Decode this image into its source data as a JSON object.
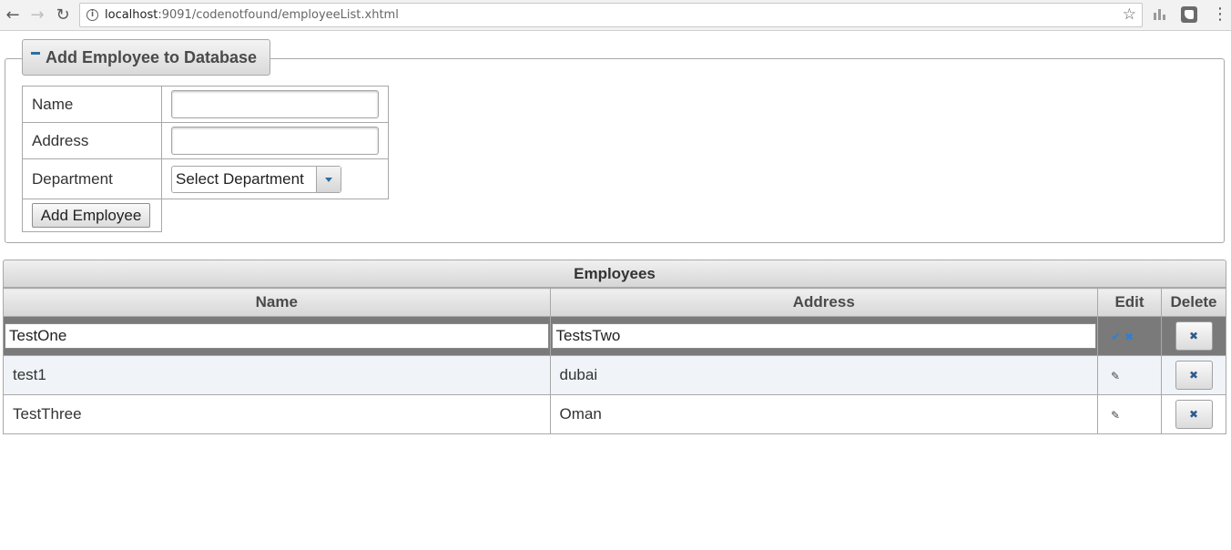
{
  "browser": {
    "url_host": "localhost",
    "url_rest": ":9091/codenotfound/employeeList.xhtml"
  },
  "add_panel": {
    "legend": "Add Employee to Database",
    "name_label": "Name",
    "name_value": "",
    "address_label": "Address",
    "address_value": "",
    "department_label": "Department",
    "department_selected": "Select Department",
    "submit_label": "Add Employee"
  },
  "employees": {
    "caption": "Employees",
    "columns": [
      "Name",
      "Address",
      "Edit",
      "Delete"
    ],
    "editing_row": {
      "name": "TestOne",
      "address": "TestsTwo"
    },
    "rows": [
      {
        "name": "test1",
        "address": "dubai"
      },
      {
        "name": "TestThree",
        "address": "Oman"
      }
    ]
  },
  "icons": {
    "back": "back-arrow-icon",
    "forward": "forward-arrow-icon",
    "reload": "reload-icon",
    "info": "info-icon",
    "star": "star-icon",
    "edit": "pencil-icon",
    "save": "check-icon",
    "cancel": "close-icon",
    "delete": "close-icon"
  },
  "colors": {
    "accent": "#2e6e9e",
    "row_highlight": "#7a7a7a",
    "odd_row": "#f0f4f8"
  }
}
